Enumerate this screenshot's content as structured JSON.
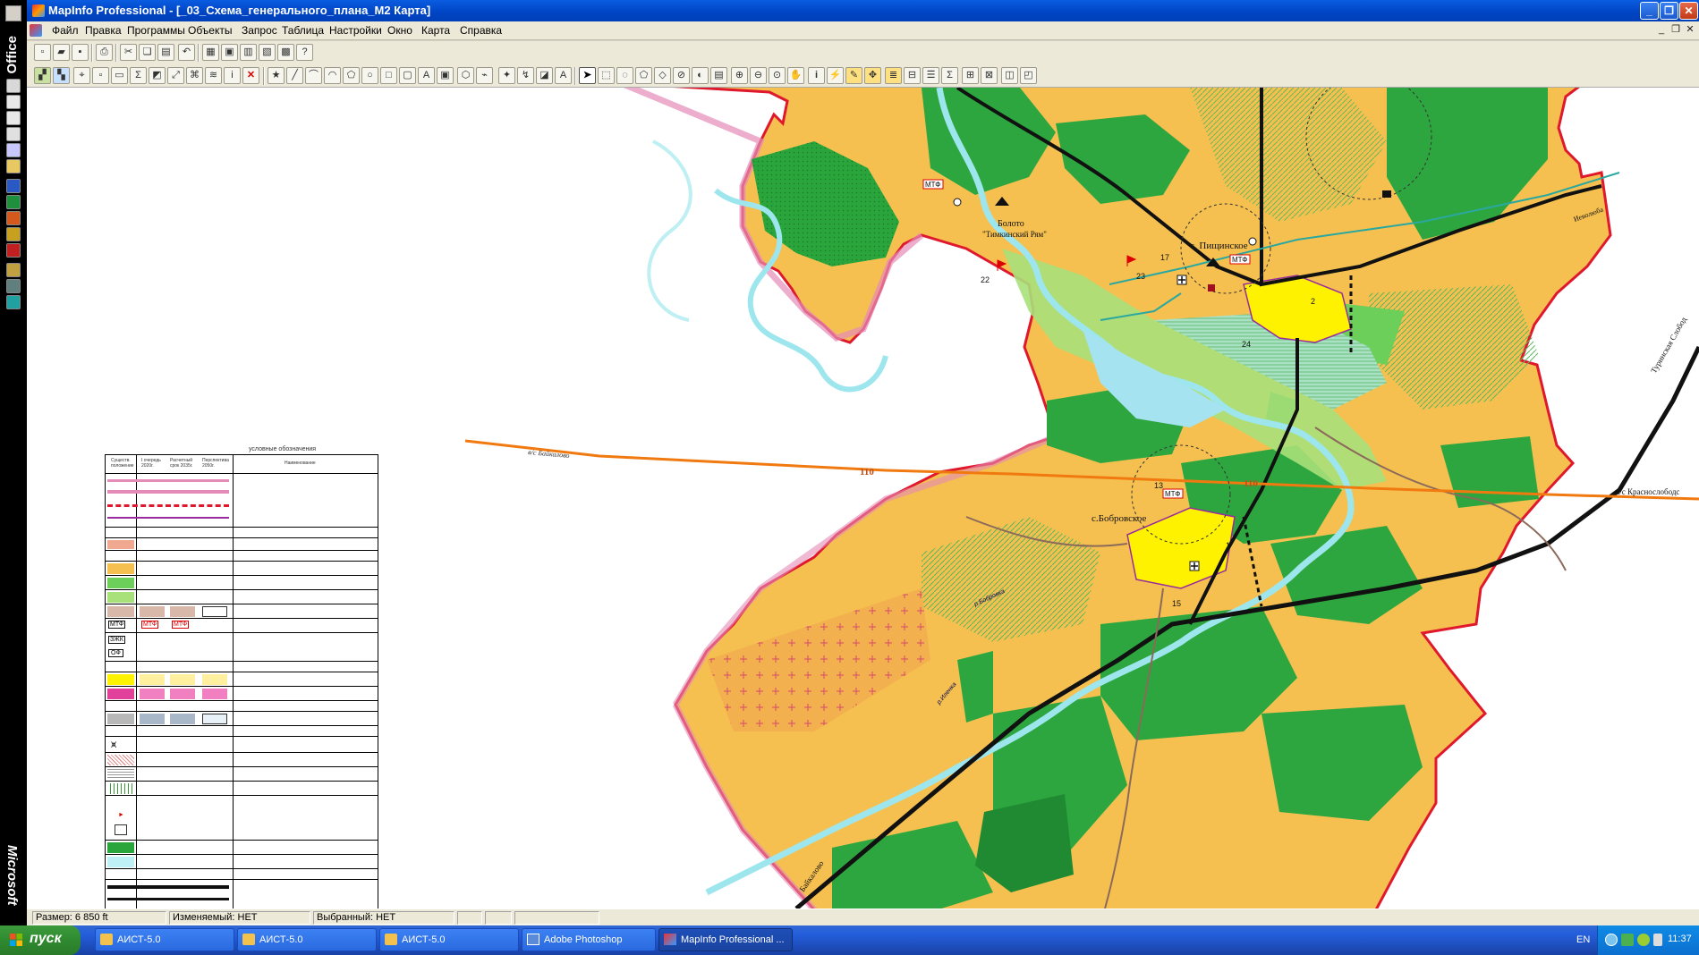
{
  "window": {
    "title": "MapInfo Professional - [_03_Схема_генерального_плана_M2 Карта]"
  },
  "office_bar": {
    "top_label": "Office",
    "bottom_label": "Microsoft"
  },
  "menu": [
    "Файл",
    "Правка",
    "Программы",
    "Объекты",
    "Запрос",
    "Таблица",
    "Настройки",
    "Окно",
    "Карта",
    "Справка"
  ],
  "map": {
    "labels": {
      "village_north": "с. Пищинское",
      "village_center": "с.Бобровское",
      "bog": "Болото",
      "bog_name": "\"Тимкинский Рям\"",
      "road_left": "в/с Байкалово",
      "road_right": "в/с Краснослободс",
      "road_diag": "Туринская Слобод",
      "road_bottom": "Байкалово",
      "road_ne": "Иеволюба",
      "line_code": "110",
      "mtf_1": "МТФ",
      "mtf_2": "МТФ",
      "mtf_3": "МТФ",
      "num_22": "22",
      "num_23": "23",
      "num_24": "24",
      "num_13": "13",
      "num_15": "15",
      "num_17": "17",
      "num_2": "2",
      "num_1": "1",
      "river_1": "р.Бобровка",
      "river_2": "р.Иленка"
    }
  },
  "legend": {
    "title": "условные обозначения",
    "headers": [
      "Существ. положение",
      "I очередь 2020г.",
      "Расчетный срок 2035г.",
      "Перспектива 2050г.",
      "Наименование"
    ],
    "badges": {
      "mtf": "МТФ",
      "zhk": "ЗЖК",
      "ofp": "ОФ"
    }
  },
  "status_bar": {
    "size": "Размер: 6 850 ft",
    "edited": "Изменяемый: НЕТ",
    "selected": "Выбранный: НЕТ"
  },
  "taskbar": {
    "start": "пуск",
    "tasks": [
      "АИСТ-5.0",
      "АИСТ-5.0",
      "АИСТ-5.0",
      "Adobe Photoshop",
      "MapInfo Professional ..."
    ],
    "lang": "EN",
    "clock": "11:37"
  },
  "colors": {
    "title_blue": "#0a5ce0",
    "taskbar_blue": "#245edb",
    "start_green": "#2f8a2f",
    "map_orange": "#f5c050",
    "map_green": "#27a83b",
    "map_light_green": "#a8e07a",
    "boundary_red": "#e0182d",
    "power_line_orange": "#f07a10",
    "river_cyan": "#9ee6ee",
    "settlement_yellow": "#fff200"
  }
}
